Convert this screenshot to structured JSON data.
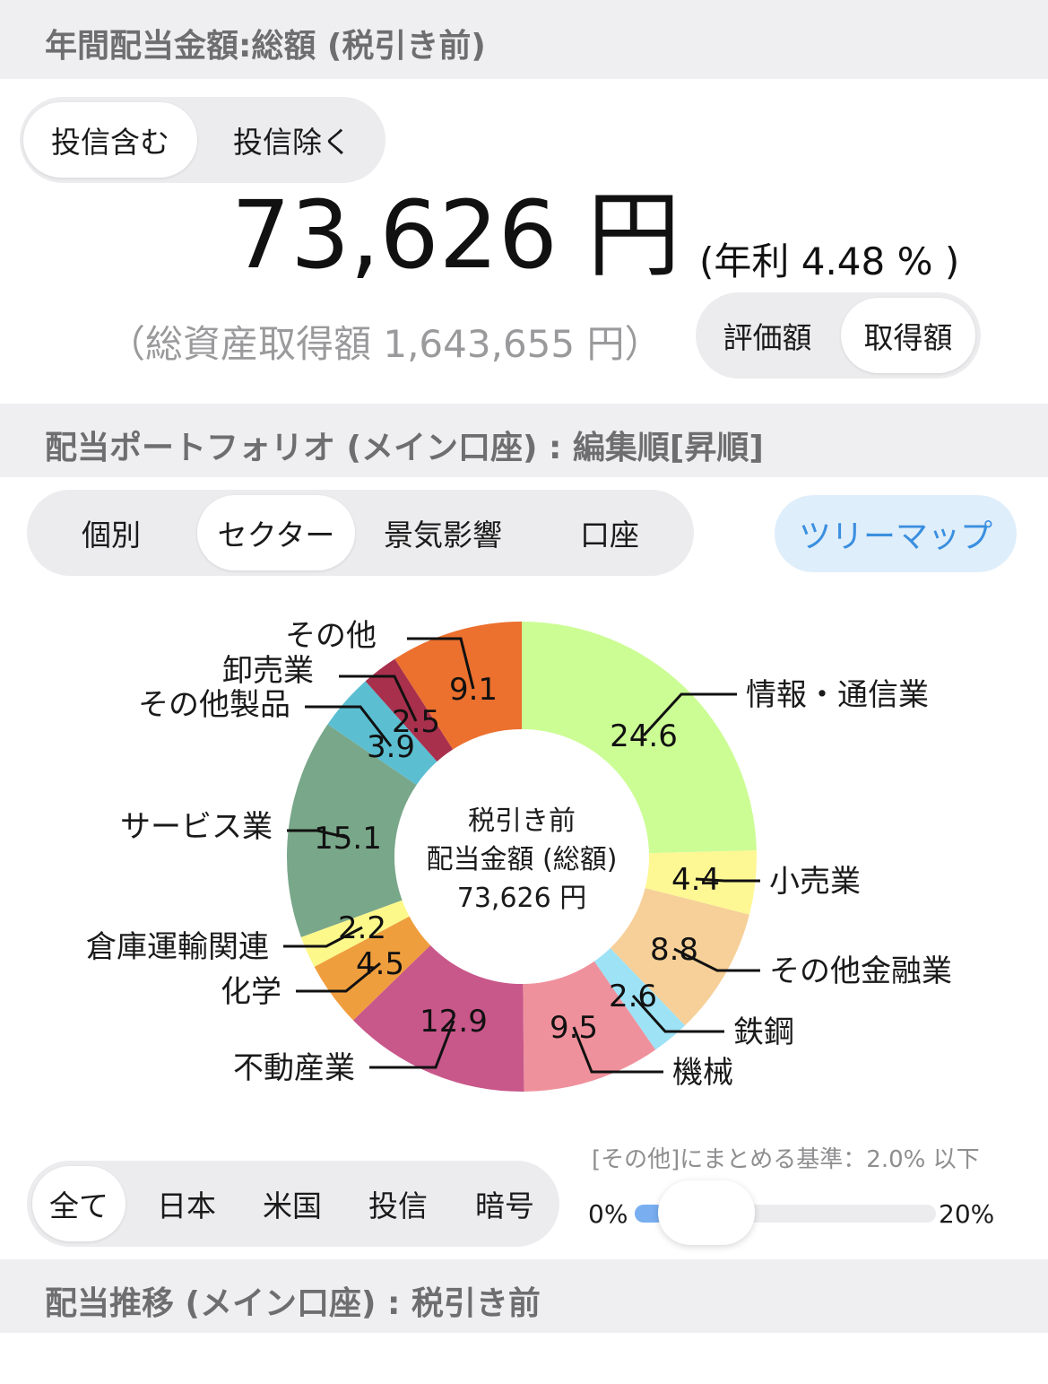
{
  "sections": {
    "annual_title": "年間配当金額:総額 (税引き前)",
    "portfolio_title": "配当ポートフォリオ (メイン口座) : 編集順[昇順]",
    "trend_title": "配当推移 (メイン口座) : 税引き前"
  },
  "fund_toggle": {
    "options": [
      "投信含む",
      "投信除く"
    ],
    "selected": "投信含む"
  },
  "summary": {
    "amount": "73,626 円",
    "yield": "(年利 4.48 % )",
    "cost_basis": "（総資産取得額 1,643,655 円）"
  },
  "basis_toggle": {
    "options": [
      "評価額",
      "取得額"
    ],
    "selected": "取得額"
  },
  "view_tabs": {
    "options": [
      "個別",
      "セクター",
      "景気影響",
      "口座"
    ],
    "selected": "セクター"
  },
  "treemap_button": "ツリーマップ",
  "market_tabs": {
    "options": [
      "全て",
      "日本",
      "米国",
      "投信",
      "暗号"
    ],
    "selected": "全て"
  },
  "slider": {
    "label": "[その他]にまとめる基準：2.0% 以下",
    "min_label": "0%",
    "max_label": "20%",
    "value_percent": 2.0
  },
  "chart_data": {
    "type": "pie",
    "center_lines": [
      "税引き前",
      "配当金額 (総額)",
      "73,626 円"
    ],
    "series": [
      {
        "values": [
          24.6,
          4.4,
          8.8,
          2.6,
          9.5,
          12.9,
          4.5,
          2.2,
          15.1,
          3.9,
          2.5,
          9.1
        ]
      }
    ],
    "categories": [
      "情報・通信業",
      "小売業",
      "その他金融業",
      "鉄鋼",
      "機械",
      "不動産業",
      "化学",
      "倉庫運輸関連",
      "サービス業",
      "その他製品",
      "卸売業",
      "その他"
    ],
    "colors": [
      "#ccfd95",
      "#fdf794",
      "#f6d098",
      "#9ee2f6",
      "#ef919c",
      "#c8578a",
      "#ef9e3e",
      "#fdf88a",
      "#79a789",
      "#5cbed1",
      "#a8304d",
      "#ec702e"
    ]
  }
}
